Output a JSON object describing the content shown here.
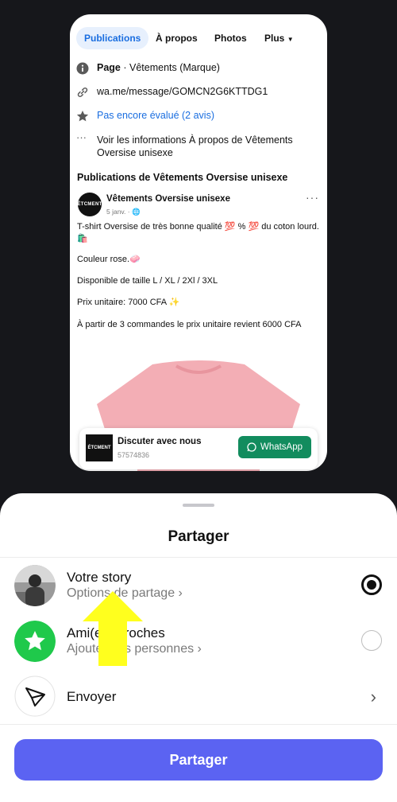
{
  "preview": {
    "tabs": [
      "Publications",
      "À propos",
      "Photos",
      "Plus"
    ],
    "info": {
      "page_label": "Page",
      "page_category": " · Vêtements (Marque)",
      "messenger_link": "wa.me/message/GOMCN2G6KTTDG1",
      "rating": "Pas encore évalué (2 avis)",
      "about": "Voir les informations À propos de Vêtements Oversise unisexe"
    },
    "section_title": "Publications de Vêtements Oversise unisexe",
    "post": {
      "logo_text": "ÉTCMENT",
      "author": "Vêtements Oversise unisexe",
      "date": "5 janv. ·",
      "lines": [
        "T-shirt Oversise de très bonne qualité 💯 % 💯 du coton lourd.🛍️",
        "Couleur rose.🧼",
        "Disponible de taille L / XL / 2Xl / 3XL",
        "Prix unitaire: 7000 CFA ✨",
        "À partir de 3 commandes le prix unitaire revient 6000 CFA"
      ]
    },
    "cta": {
      "logo_text": "ÉTCMENT",
      "title": "Discuter avec nous",
      "number": "57574836",
      "button": "WhatsApp"
    }
  },
  "sheet": {
    "title": "Partager",
    "options": [
      {
        "title": "Votre story",
        "subtitle": "Options de partage ›",
        "selected": true
      },
      {
        "title": "Ami(e)s proches",
        "subtitle": "Ajouter des personnes ›",
        "selected": false
      },
      {
        "title": "Envoyer",
        "subtitle": ""
      }
    ],
    "share_button": "Partager"
  },
  "colors": {
    "accent": "#5b63f2",
    "whatsapp": "#128c5e",
    "close_friends": "#1fc94b",
    "link_blue": "#1a6ee0",
    "highlight_arrow": "#ffff1e"
  }
}
